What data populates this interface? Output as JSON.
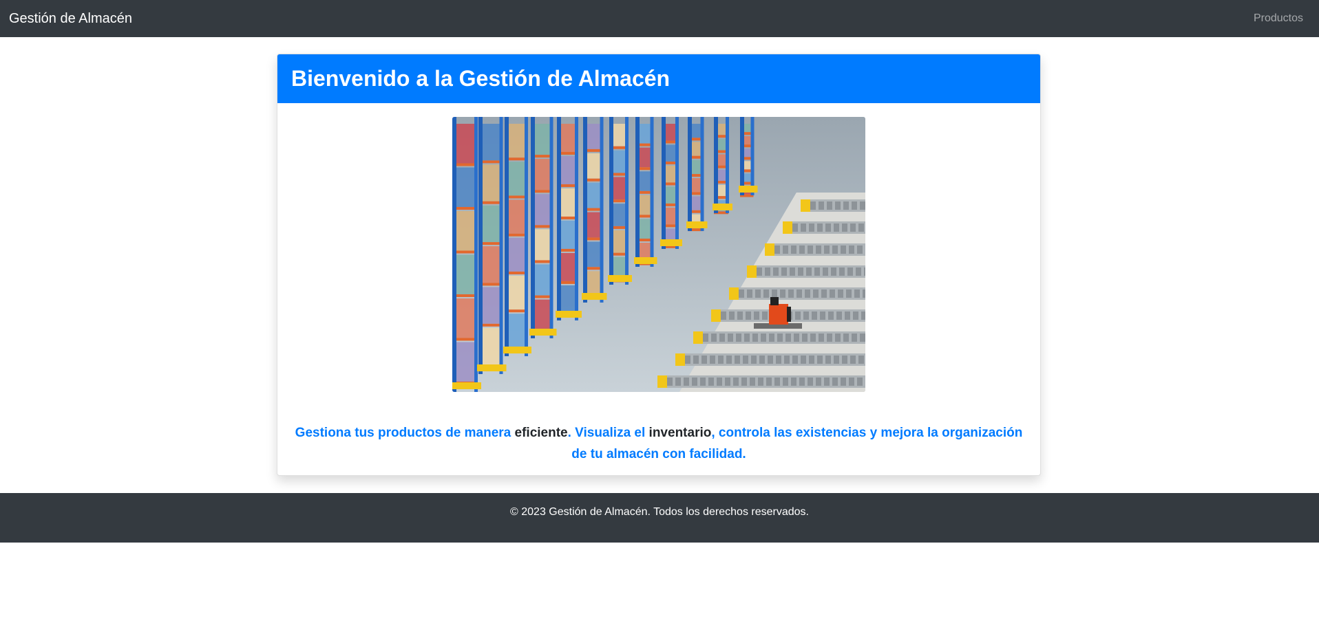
{
  "navbar": {
    "brand": "Gestión de Almacén",
    "links": [
      {
        "label": "Productos"
      }
    ]
  },
  "card": {
    "title": "Bienvenido a la Gestión de Almacén",
    "description_parts": [
      "Gestiona tus productos de manera ",
      "eficiente",
      ". Visualiza el ",
      "inventario",
      ", controla las existencias y mejora la organización de tu almacén con facilidad."
    ],
    "image": {
      "subject": "warehouse-aisles-with-shelving-and-pallet-truck"
    }
  },
  "footer": {
    "text": "© 2023 Gestión de Almacén. Todos los derechos reservados."
  },
  "colors": {
    "navbar_bg": "#343a40",
    "primary": "#007bff",
    "text_dark": "#212529"
  }
}
